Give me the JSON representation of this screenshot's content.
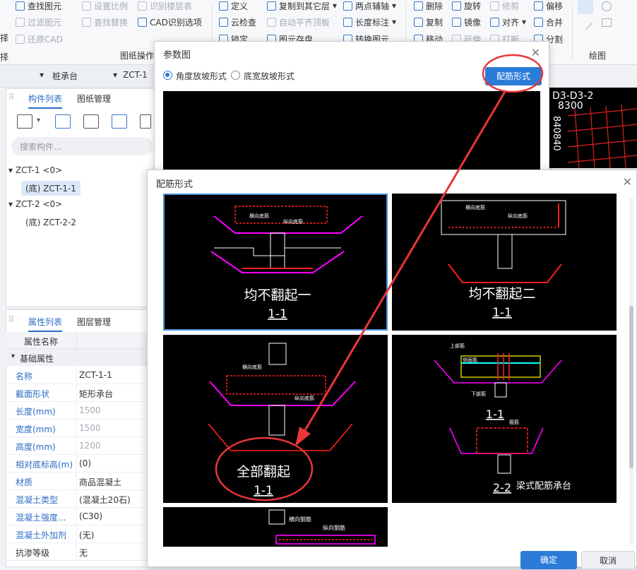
{
  "ribbon": {
    "col1": [
      "查找图元",
      "过滤图元",
      "择",
      "还原CAD"
    ],
    "col2": [
      "设置比例",
      "查找替换",
      "识别楼层表",
      "CAD识别选项"
    ],
    "col3": [
      "定义",
      "云检查",
      "锁定"
    ],
    "col4": [
      "复制到其它层",
      "自动平齐顶板",
      "图元存盘"
    ],
    "col5": [
      "两点辅轴",
      "长度标注",
      "转换图元"
    ],
    "col6": [
      "删除",
      "复制",
      "移动"
    ],
    "col7": [
      "旋转",
      "镜像",
      "延伸"
    ],
    "col8": [
      "修剪",
      "对齐",
      "打断"
    ],
    "col9": [
      "偏移",
      "合并",
      "分割"
    ],
    "group_labels": [
      "图纸操作",
      "绘图"
    ],
    "left_label": "择"
  },
  "tabrow": {
    "dropdown1": "",
    "dropdown2": "桩承台",
    "dropdown3": "ZCT-1"
  },
  "components_panel": {
    "tabs": [
      "构件列表",
      "图纸管理"
    ],
    "search_placeholder": "搜索构件...",
    "tree": [
      {
        "label": "ZCT-1 <0>",
        "children": [
          "(底) ZCT-1-1"
        ]
      },
      {
        "label": "ZCT-2 <0>",
        "children": [
          "(底) ZCT-2-2"
        ]
      }
    ]
  },
  "properties_panel": {
    "tabs": [
      "属性列表",
      "图层管理"
    ],
    "header": "属性名称",
    "section": "基础属性",
    "rows": [
      {
        "k": "名称",
        "v": "ZCT-1-1"
      },
      {
        "k": "截面形状",
        "v": "矩形承台"
      },
      {
        "k": "长度(mm)",
        "v": "1500"
      },
      {
        "k": "宽度(mm)",
        "v": "1500"
      },
      {
        "k": "高度(mm)",
        "v": "1200"
      },
      {
        "k": "相对底标高(m)",
        "v": "(0)"
      },
      {
        "k": "材质",
        "v": "商品混凝土"
      },
      {
        "k": "混凝土类型",
        "v": "(混凝土20石)"
      },
      {
        "k": "混凝土强度...",
        "v": "(C30)"
      },
      {
        "k": "混凝土外加剂",
        "v": "(无)"
      },
      {
        "k": "抗渗等级",
        "v": "无"
      }
    ]
  },
  "canvas": {
    "labels": [
      "D3-D3-2",
      "8300",
      "840840"
    ]
  },
  "dialog_params": {
    "title": "参数图",
    "radio1": "角度放坡形式",
    "radio2": "底宽放坡形式",
    "button": "配筋形式"
  },
  "dialog_rebar": {
    "title": "配筋形式",
    "options": [
      {
        "title": "均不翻起一",
        "section": "1-1"
      },
      {
        "title": "均不翻起二",
        "section": "1-1"
      },
      {
        "title": "全部翻起",
        "section": "1-1"
      },
      {
        "title": "梁式配筋承台",
        "section": "1-1",
        "section2": "2-2"
      }
    ],
    "labels": {
      "horiz": "横向底筋",
      "long": "纵向底筋",
      "horiz_steel": "横向钢筋",
      "long_steel": "纵向钢筋",
      "top": "上部筋",
      "side": "侧面筋",
      "bottom": "下部筋",
      "stirrup": "箍筋"
    },
    "ok": "确定",
    "cancel": "取消"
  },
  "colors": {
    "accent": "#2b7cd8",
    "annotation": "#e8363a",
    "cad_red": "#ff2020",
    "cad_magenta": "#ff00ff"
  }
}
